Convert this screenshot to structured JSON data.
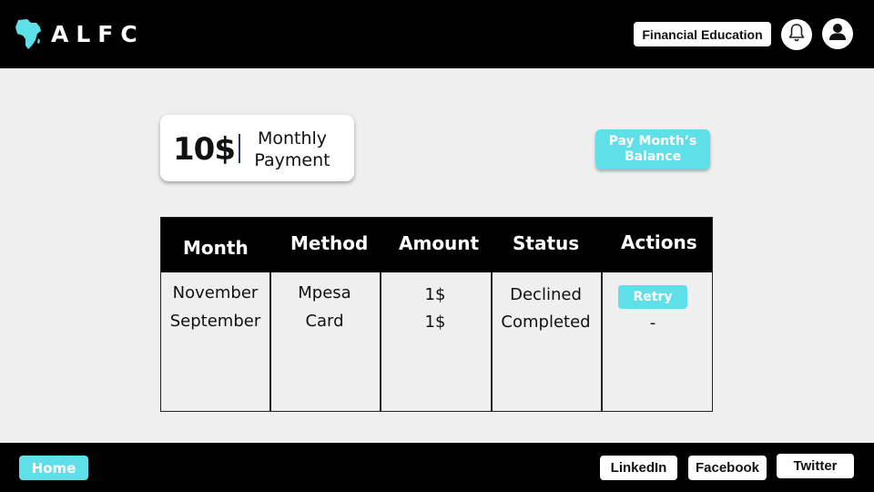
{
  "header": {
    "logo_text": "ALFC",
    "financial_education_label": "Financial Education",
    "icons": {
      "notifications": "bell-icon",
      "profile": "user-icon",
      "logo": "africa-map-icon"
    }
  },
  "summary": {
    "amount": "10$",
    "label": "Monthly Payment"
  },
  "pay_balance_label": "Pay Month’s Balance",
  "table": {
    "headers": [
      "Month",
      "Method",
      "Amount",
      "Status",
      "Actions"
    ],
    "rows": [
      {
        "month": "November",
        "method": "Mpesa",
        "amount": "1$",
        "status": "Declined",
        "action": "Retry"
      },
      {
        "month": "September",
        "method": "Card",
        "amount": "1$",
        "status": "Completed",
        "action": "-"
      }
    ]
  },
  "footer": {
    "home_label": "Home",
    "linkedin_label": "LinkedIn",
    "facebook_label": "Facebook",
    "twitter_label": "Twitter"
  },
  "colors": {
    "accent": "#5fe0e8",
    "header_bg": "#000000",
    "page_bg": "#efefef",
    "divider": "#1e3a6e"
  }
}
